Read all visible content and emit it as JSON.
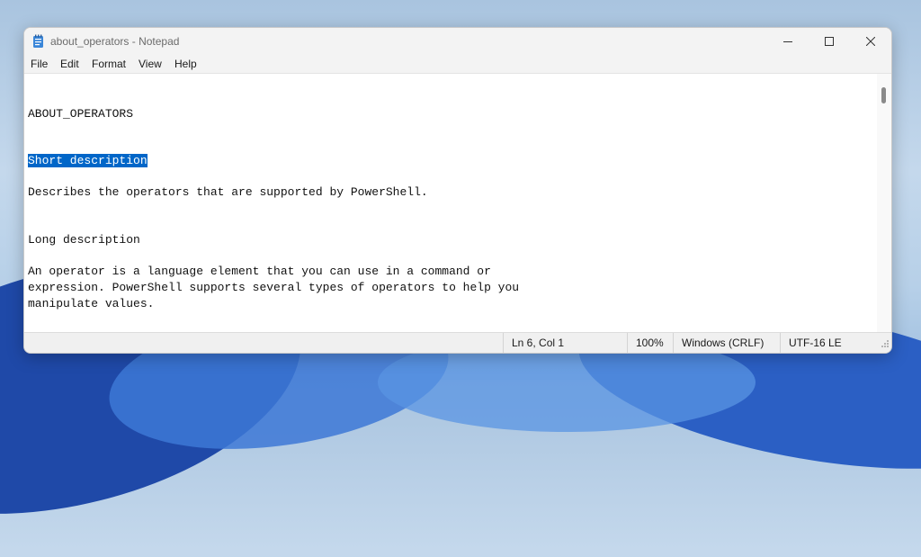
{
  "window": {
    "title": "about_operators - Notepad"
  },
  "menu": [
    "File",
    "Edit",
    "Format",
    "View",
    "Help"
  ],
  "document": {
    "lines": [
      "ABOUT_OPERATORS",
      "Short description",
      "Describes the operators that are supported by PowerShell.",
      "Long description",
      "An operator is a language element that you can use in a command or",
      "expression. PowerShell supports several types of operators to help you",
      "manipulate values."
    ],
    "selected_line_index": 1
  },
  "status": {
    "cursor": "Ln 6, Col 1",
    "zoom": "100%",
    "line_ending": "Windows (CRLF)",
    "encoding": "UTF-16 LE"
  },
  "icons": {
    "app": "notepad-icon",
    "minimize": "minimize-icon",
    "maximize": "maximize-icon",
    "close": "close-icon",
    "grip": "resize-grip-icon"
  },
  "colors": {
    "selection": "#0066c8",
    "titlebar": "#f3f3f3"
  }
}
